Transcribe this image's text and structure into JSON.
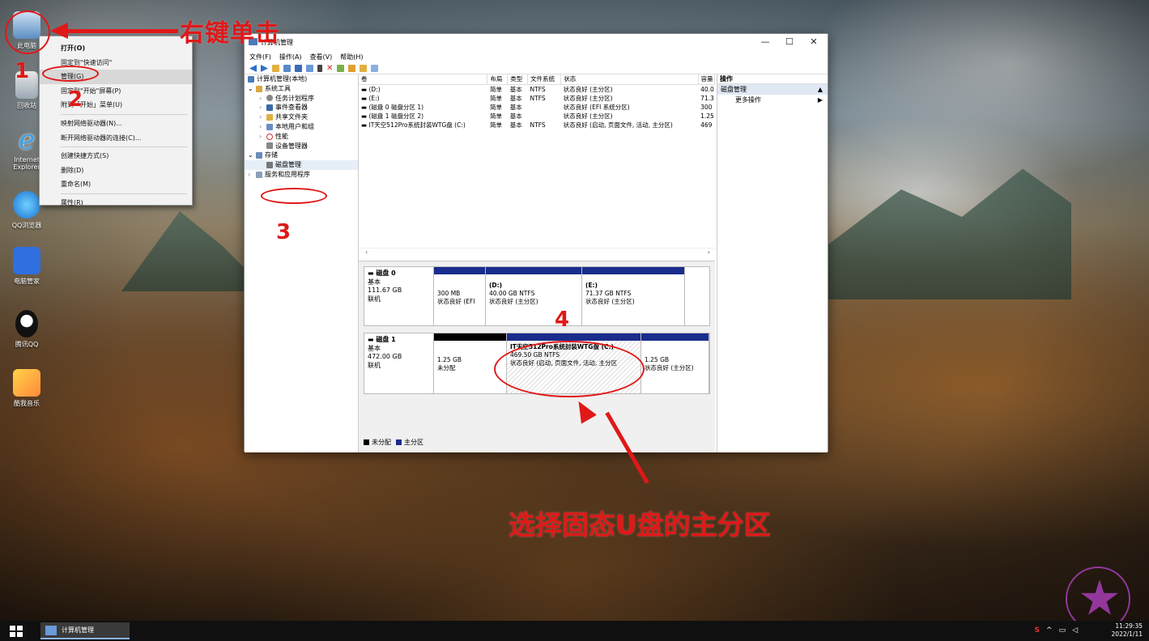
{
  "desktop": {
    "icons": [
      {
        "label": "此电脑"
      },
      {
        "label": "回收站"
      },
      {
        "label": "Internet Explorer"
      },
      {
        "label": "QQ浏览器"
      },
      {
        "label": "电脑管家"
      },
      {
        "label": "腾讯QQ"
      },
      {
        "label": "酷我音乐"
      }
    ]
  },
  "context_menu": {
    "items": [
      "打开(O)",
      "固定到\"快速访问\"",
      "管理(G)",
      "固定到\"开始\"屏幕(P)",
      "附到「开始」菜单(U)",
      "映射网络驱动器(N)...",
      "断开网络驱动器的连接(C)...",
      "创建快捷方式(S)",
      "删除(D)",
      "重命名(M)",
      "属性(R)"
    ]
  },
  "window": {
    "title": "计算机管理",
    "menu": [
      "文件(F)",
      "操作(A)",
      "查看(V)",
      "帮助(H)"
    ],
    "controls": {
      "minimize": "—",
      "maximize": "☐",
      "close": "✕"
    },
    "tree": {
      "root": "计算机管理(本地)",
      "system_tools": "系统工具",
      "task_scheduler": "任务计划程序",
      "event_viewer": "事件查看器",
      "shared_folders": "共享文件夹",
      "local_users": "本地用户和组",
      "performance": "性能",
      "device_manager": "设备管理器",
      "storage": "存储",
      "disk_management": "磁盘管理",
      "services": "服务和应用程序"
    },
    "volumes": {
      "headers": [
        "卷",
        "布局",
        "类型",
        "文件系统",
        "状态",
        "容量"
      ],
      "rows": [
        [
          "(D:)",
          "简单",
          "基本",
          "NTFS",
          "状态良好 (主分区)",
          "40.0"
        ],
        [
          "(E:)",
          "简单",
          "基本",
          "NTFS",
          "状态良好 (主分区)",
          "71.3"
        ],
        [
          "(磁盘 0 磁盘分区 1)",
          "简单",
          "基本",
          "",
          "状态良好 (EFI 系统分区)",
          "300"
        ],
        [
          "(磁盘 1 磁盘分区 2)",
          "简单",
          "基本",
          "",
          "状态良好 (主分区)",
          "1.25"
        ],
        [
          "IT天空512Pro系统封装WTG盘 (C:)",
          "简单",
          "基本",
          "NTFS",
          "状态良好 (启动, 页面文件, 活动, 主分区)",
          "469"
        ]
      ]
    },
    "disks": [
      {
        "name": "磁盘 0",
        "type": "基本",
        "size": "111.67 GB",
        "state": "联机",
        "partitions": [
          {
            "title": "",
            "size": "300 MB",
            "status": "状态良好 (EFI",
            "bar": "#1a2d8c"
          },
          {
            "title": "(D:)",
            "size": "40.00 GB NTFS",
            "status": "状态良好 (主分区)",
            "bar": "#1a2d8c"
          },
          {
            "title": "(E:)",
            "size": "71.37 GB NTFS",
            "status": "状态良好 (主分区)",
            "bar": "#1a2d8c"
          }
        ]
      },
      {
        "name": "磁盘 1",
        "type": "基本",
        "size": "472.00 GB",
        "state": "联机",
        "partitions": [
          {
            "title": "",
            "size": "1.25 GB",
            "status": "未分配",
            "bar": "#000000"
          },
          {
            "title": "IT天空512Pro系统封装WTG盘  (C:)",
            "size": "469.50 GB NTFS",
            "status": "状态良好 (启动, 页面文件, 活动, 主分区",
            "bar": "#1a2d8c"
          },
          {
            "title": "",
            "size": "1.25 GB",
            "status": "状态良好 (主分区)",
            "bar": "#1a2d8c"
          }
        ]
      }
    ],
    "legend": {
      "unallocated": "未分配",
      "primary": "主分区"
    },
    "actions": {
      "header": "操作",
      "section": "磁盘管理",
      "more": "更多操作"
    }
  },
  "annotations": {
    "right_click": "右键单击",
    "step1": "1",
    "step2": "2",
    "step3": "3",
    "step4": "4",
    "bottom_text": "选择固态U盘的主分区"
  },
  "taskbar": {
    "app": "计算机管理",
    "time": "11:29:35",
    "date": "2022/1/11"
  }
}
